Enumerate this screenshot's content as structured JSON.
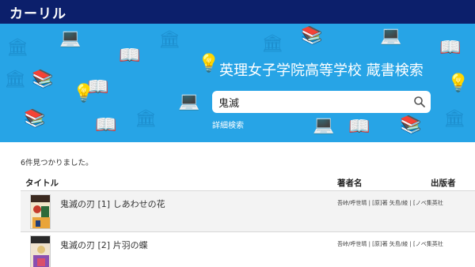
{
  "app": {
    "logo": "カーリル"
  },
  "hero": {
    "library_title": "英理女子学院高等学校 蔵書検索",
    "search": {
      "value": "鬼滅",
      "placeholder": ""
    },
    "advanced_link": "詳細検索"
  },
  "results": {
    "count_text": "6件見つかりました。",
    "columns": {
      "title": "タイトル",
      "author": "著者名",
      "publisher": "出版者"
    },
    "rows": [
      {
        "title": "鬼滅の刃 [1] しあわせの花",
        "author": "吾峠/呼世晴 | [原]著 矢島/綾 | [ノベ集英社"
      },
      {
        "title": "鬼滅の刃 [2] 片羽の蝶",
        "author": "吾峠/呼世晴 | [原]著 矢島/綾 | [ノベ集英社"
      }
    ]
  },
  "colors": {
    "topbar": "#0c1f6b",
    "hero": "#27a4e6",
    "deco": "#1d8fcf"
  },
  "icons": {
    "search": "search-icon",
    "hero_decor": "library-pattern-icons"
  }
}
